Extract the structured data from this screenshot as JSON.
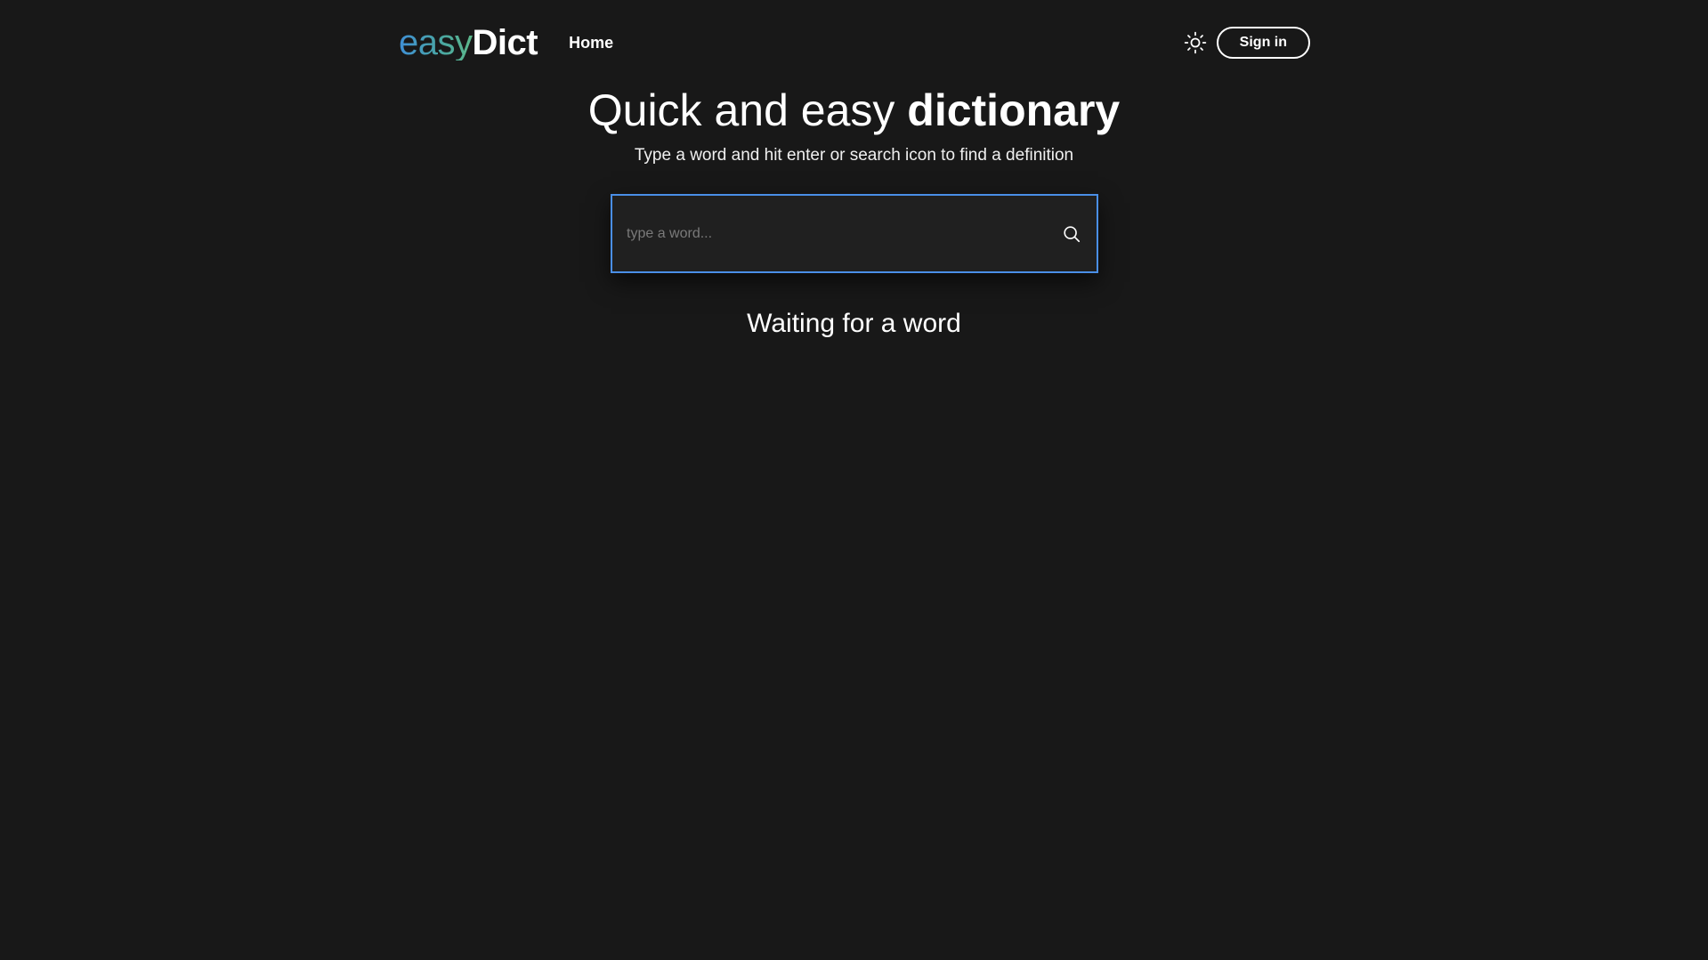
{
  "header": {
    "logo_part1": "easy",
    "logo_part2": "Dict",
    "nav_home": "Home",
    "theme_icon": "sun-icon",
    "signin_label": "Sign in"
  },
  "hero": {
    "title_regular": "Quick and easy ",
    "title_bold": "dictionary",
    "subtitle": "Type a word and hit enter or search icon to find a definition"
  },
  "search": {
    "placeholder": "type a word...",
    "value": "",
    "icon": "search-icon"
  },
  "status": {
    "message": "Waiting for a word"
  },
  "colors": {
    "background": "#181818",
    "input_border": "#4a8fe7",
    "logo_gradient_start": "#3f8fd6",
    "logo_gradient_end": "#5db88a"
  }
}
